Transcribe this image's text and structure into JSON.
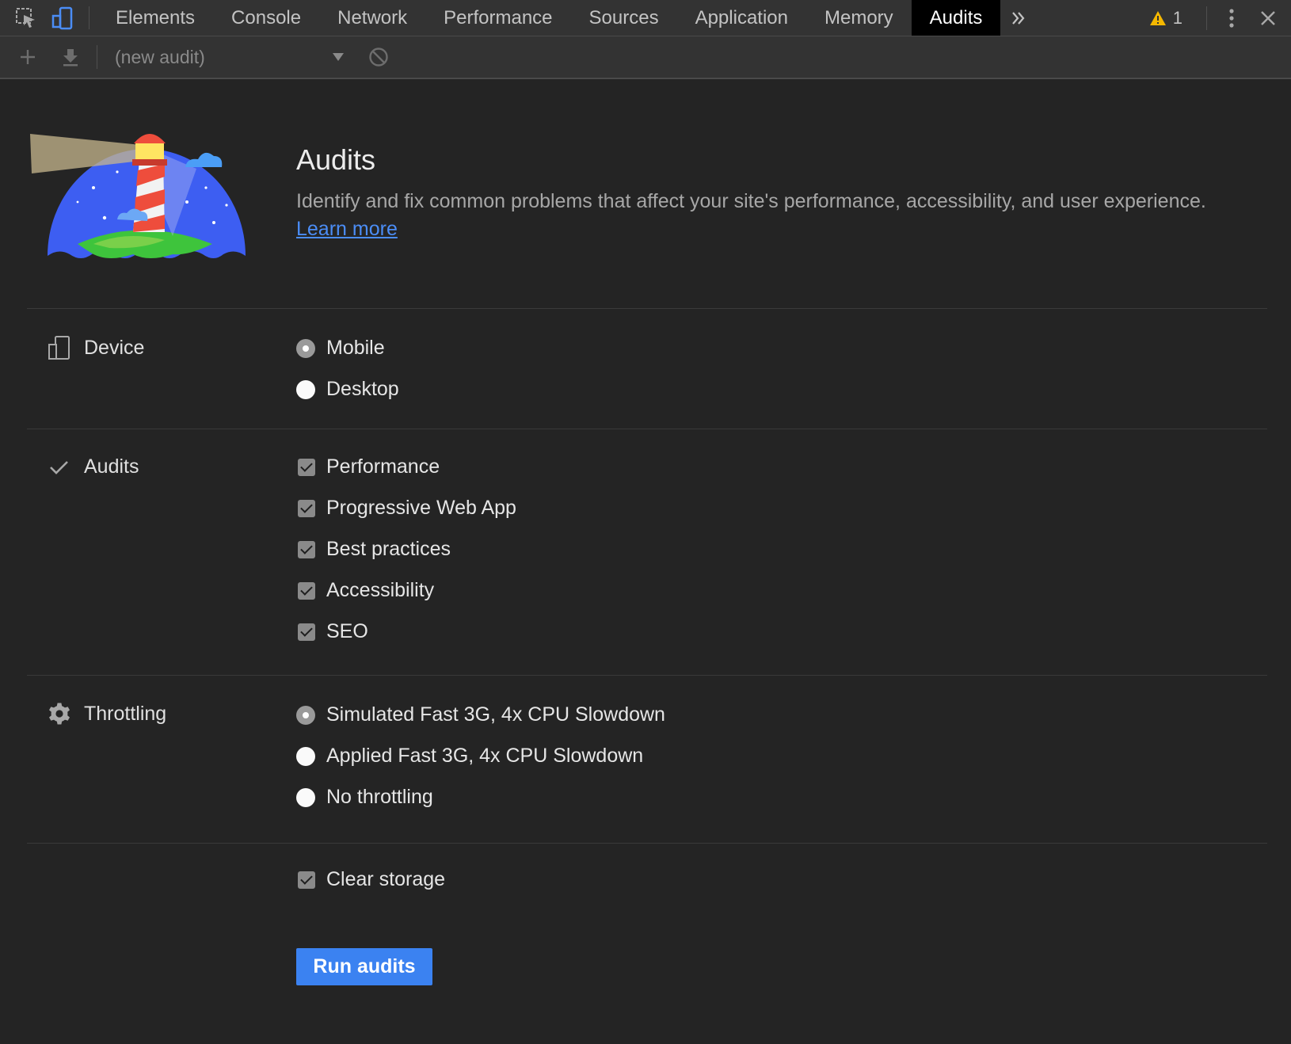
{
  "tabs": [
    "Elements",
    "Console",
    "Network",
    "Performance",
    "Sources",
    "Application",
    "Memory",
    "Audits"
  ],
  "active_tab": "Audits",
  "warning_count": "1",
  "toolbar": {
    "audit_select": "(new audit)"
  },
  "header": {
    "title": "Audits",
    "description": "Identify and fix common problems that affect your site's performance, accessibility, and user experience.",
    "learn_more": "Learn more"
  },
  "device": {
    "label": "Device",
    "options": [
      {
        "label": "Mobile",
        "checked": true
      },
      {
        "label": "Desktop",
        "checked": false
      }
    ]
  },
  "audits": {
    "label": "Audits",
    "items": [
      {
        "label": "Performance",
        "checked": true
      },
      {
        "label": "Progressive Web App",
        "checked": true
      },
      {
        "label": "Best practices",
        "checked": true
      },
      {
        "label": "Accessibility",
        "checked": true
      },
      {
        "label": "SEO",
        "checked": true
      }
    ]
  },
  "throttling": {
    "label": "Throttling",
    "options": [
      {
        "label": "Simulated Fast 3G, 4x CPU Slowdown",
        "checked": true
      },
      {
        "label": "Applied Fast 3G, 4x CPU Slowdown",
        "checked": false
      },
      {
        "label": "No throttling",
        "checked": false
      }
    ]
  },
  "clear_storage": {
    "label": "Clear storage",
    "checked": true
  },
  "run_button": "Run audits",
  "colors": {
    "accent": "#3b82f1",
    "link": "#4b8df6",
    "background": "#242424",
    "tabbar": "#333333"
  }
}
